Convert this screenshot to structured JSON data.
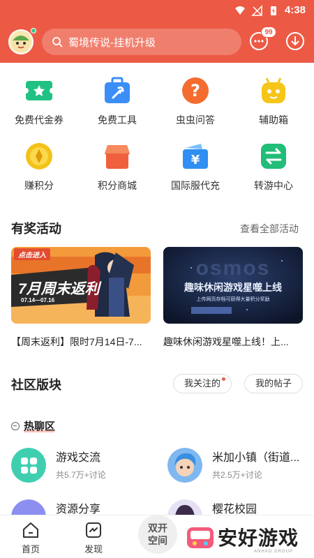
{
  "status": {
    "time": "4:38"
  },
  "search": {
    "placeholder": "蜀境传说-挂机升级"
  },
  "messages": {
    "badge": "99"
  },
  "grid": [
    {
      "label": "免费代金券",
      "icon": "voucher-icon",
      "color": "#21c184"
    },
    {
      "label": "免费工具",
      "icon": "toolbox-icon",
      "color": "#3a8ef5"
    },
    {
      "label": "虫虫问答",
      "icon": "question-icon",
      "color": "#f46c2f"
    },
    {
      "label": "辅助箱",
      "icon": "robot-icon",
      "color": "#f5c518"
    },
    {
      "label": "赚积分",
      "icon": "coin-icon",
      "color": "#f3c21a"
    },
    {
      "label": "积分商城",
      "icon": "shop-icon",
      "color": "#f0603c"
    },
    {
      "label": "国际服代充",
      "icon": "yen-wallet-icon",
      "color": "#2f8ff2"
    },
    {
      "label": "转游中心",
      "icon": "swap-icon",
      "color": "#22bd78"
    }
  ],
  "activities": {
    "title": "有奖活动",
    "more": "查看全部活动",
    "items": [
      {
        "tag": "点击进入",
        "headline": "7月周末返利",
        "dates": "07.14—07.16",
        "caption": "【周末返利】限时7月14日-7..."
      },
      {
        "headline": "趣味休闲游戏星噬上线",
        "sub": "上传网页存档可获得大量积分奖励",
        "caption": "趣味休闲游戏星噬上线！上..."
      }
    ]
  },
  "community": {
    "title": "社区版块",
    "tabs": [
      "我关注的",
      "我的帖子"
    ],
    "hot": "热聊区",
    "forums": [
      {
        "name": "游戏交流",
        "sub": "共5.7万+讨论"
      },
      {
        "name": "米加小镇（街道...",
        "sub": "共2.5万+讨论"
      },
      {
        "name": "资源分享",
        "sub": ""
      },
      {
        "name": "樱花校园",
        "sub": ""
      }
    ]
  },
  "nav": {
    "home": "首页",
    "discover": "发现",
    "dual_line1": "双开",
    "dual_line2": "空间"
  },
  "watermark": {
    "text": "安好游戏",
    "sub": "ANHAO GROUP"
  },
  "colors": {
    "brand": "#ec5a45",
    "muted": "#888888"
  }
}
